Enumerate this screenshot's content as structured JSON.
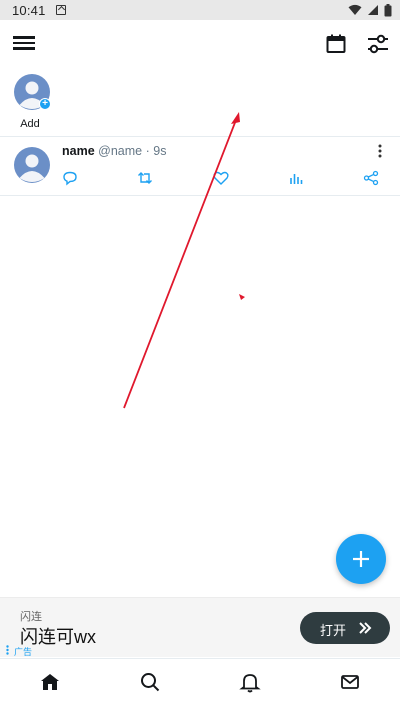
{
  "status_bar": {
    "time": "10:41",
    "icons": [
      "notification-a-icon",
      "wifi-icon",
      "signal-icon",
      "battery-icon"
    ]
  },
  "top_bar": {
    "icons": [
      "menu-icon",
      "calendar-icon",
      "filter-settings-icon"
    ]
  },
  "story": {
    "add_label": "Add"
  },
  "tweet": {
    "name": "name",
    "handle": "@name",
    "separator": "·",
    "time": "9s",
    "actions": [
      "reply-icon",
      "retweet-icon",
      "like-icon",
      "analytics-icon",
      "share-icon"
    ]
  },
  "fab": {
    "icon": "plus-icon"
  },
  "ad": {
    "brand": "闪连",
    "title": "闪连可wx",
    "tag": "广告",
    "button_label": "打开"
  },
  "bottom_nav": {
    "items": [
      "home-icon",
      "search-icon",
      "notifications-icon",
      "messages-icon"
    ]
  },
  "colors": {
    "accent": "#1da1f2",
    "annotation": "#e0182d",
    "ad_button": "#2f3c40",
    "avatar": "#6b8fc7"
  }
}
